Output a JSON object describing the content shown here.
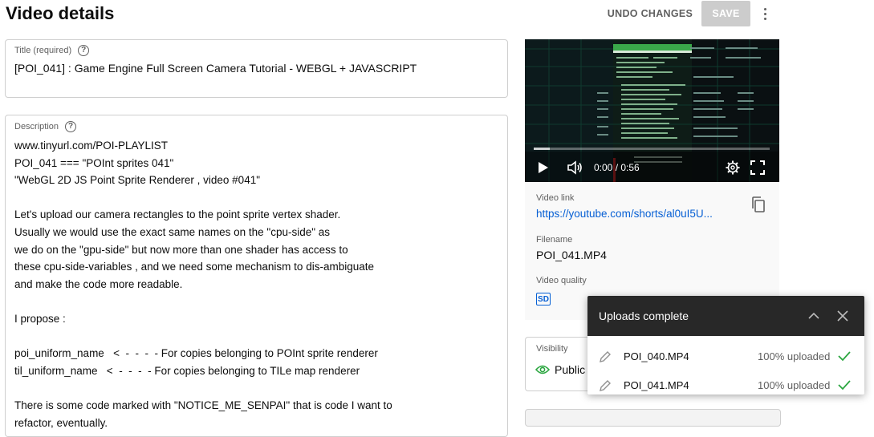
{
  "header": {
    "title": "Video details",
    "undo_label": "UNDO CHANGES",
    "save_label": "SAVE",
    "more_icon": "more-vert-icon"
  },
  "title_field": {
    "label": "Title (required)",
    "value": "[POI_041] : Game Engine Full Screen Camera Tutorial - WEBGL + JAVASCRIPT"
  },
  "description_field": {
    "label": "Description",
    "lines": [
      "www.tinyurl.com/POI-PLAYLIST",
      "POI_041 === \"POInt sprites 041\"",
      "\"WebGL 2D JS Point Sprite Renderer , video #041\"",
      "",
      "Let's upload our camera rectangles to the point sprite vertex shader.",
      "Usually we would use the exact same names on the \"cpu-side\" as",
      "we do on the \"gpu-side\" but now more than one shader has access to",
      "these cpu-side-variables , and we need some mechanism to dis-ambiguate",
      "and make the code more readable.",
      "",
      "I propose :",
      "",
      "poi_uniform_name   <  -  -  -  - For copies belonging to POInt sprite renderer",
      "til_uniform_name   <  -  -  -  - For copies belonging to TILe map renderer",
      "",
      "There is some code marked with \"NOTICE_ME_SENPAI\" that is code I want to",
      "refactor, eventually."
    ]
  },
  "player": {
    "time": "0:00 / 0:56",
    "progress": 0.0
  },
  "details": {
    "video_link_label": "Video link",
    "video_link": "https://youtube.com/shorts/al0uI5U...",
    "filename_label": "Filename",
    "filename": "POI_041.MP4",
    "quality_label": "Video quality",
    "quality_badge": "SD"
  },
  "visibility": {
    "label": "Visibility",
    "value": "Public"
  },
  "uploads": {
    "title": "Uploads complete",
    "items": [
      {
        "filename": "POI_040.MP4",
        "status": "100% uploaded"
      },
      {
        "filename": "POI_041.MP4",
        "status": "100% uploaded"
      }
    ]
  },
  "colors": {
    "accent": "#065fd4",
    "success": "#2ba640",
    "save_disabled": "#cccccc",
    "toast_header": "#282828"
  }
}
